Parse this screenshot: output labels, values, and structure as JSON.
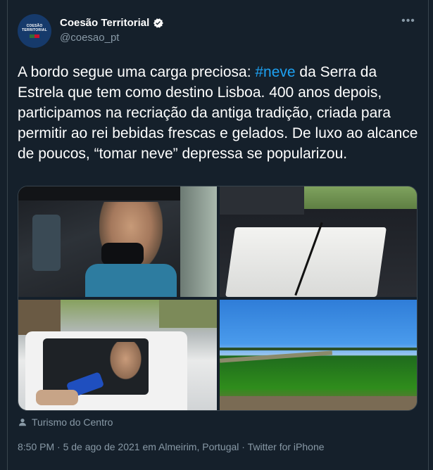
{
  "account": {
    "display_name": "Coesão Territorial",
    "handle": "@coesao_pt",
    "avatar_text": "COESÃO TERRITORIAL",
    "verified": true
  },
  "tweet": {
    "text_before": "A bordo segue uma carga preciosa: ",
    "hashtag": "#neve",
    "text_after": " da Serra da Estrela que tem como destino Lisboa. 400 anos depois, participamos na recriação da antiga tradição, criada para permitir ao rei bebidas frescas e gelados. De luxo ao alcance de poucos, “tomar neve” depressa se popularizou."
  },
  "media": {
    "photos": [
      "photo-woman-in-car",
      "photo-truck-bed-snow-box",
      "photo-car-interview",
      "photo-green-field"
    ]
  },
  "location_tag": "Turismo do Centro",
  "meta": "8:50 PM · 5 de ago de 2021 em Almeirim, Portugal · Twitter for iPhone",
  "colors": {
    "background": "#15202b",
    "accent": "#1da1f2",
    "secondary_text": "#8899a6",
    "border": "#38444d"
  },
  "icons": [
    "verified-badge-icon",
    "more-options-icon",
    "person-tag-icon"
  ]
}
